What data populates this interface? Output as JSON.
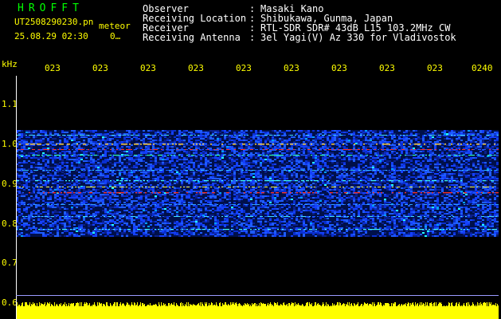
{
  "header": {
    "brand": "HROFFT",
    "filename": "UT2508290230.pn",
    "filename_suffix": "meteor",
    "datetime": "25.08.29 02:30",
    "counter": "0…",
    "fields": [
      {
        "label": "Observer",
        "value": "Masaki Kano"
      },
      {
        "label": "Receiving Location",
        "value": "Shibukawa, Gunma, Japan"
      },
      {
        "label": "Receiver",
        "value": "RTL-SDR SDR# 43dB L15 103.2MHz CW"
      },
      {
        "label": "Receiving Antenna",
        "value": "3el Yagi(V) Az 330 for Vladivostok"
      }
    ]
  },
  "axes": {
    "y_unit": "kHz",
    "y_ticks": [
      "1.1",
      "1.0",
      "0.9",
      "0.8",
      "0.7",
      "0.6"
    ],
    "x_ticks": [
      "023",
      "023",
      "023",
      "023",
      "023",
      "023",
      "023",
      "023",
      "023",
      "0240"
    ]
  },
  "colors": {
    "text": "#ffffff",
    "labels": "#ffff00",
    "brand": "#00ff00",
    "background": "#000000",
    "echo_band": "#0a2fd0",
    "strong_signal": "#ff3020",
    "baseline_noise": "#ffff00"
  }
}
